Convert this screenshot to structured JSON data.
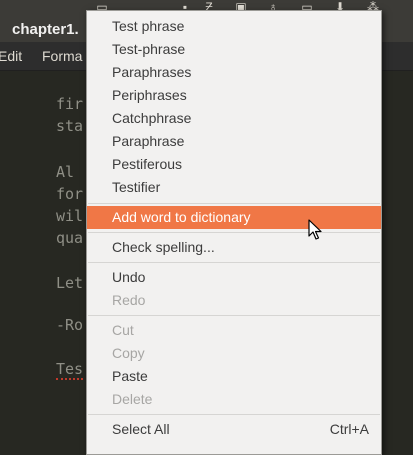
{
  "editor": {
    "tab_title": "chapter1.",
    "menu": [
      "Edit",
      "Forma"
    ],
    "lines": [
      "fir",
      "sta",
      "Al",
      "for",
      "wil",
      "qua",
      "Let",
      "-Ro",
      "Tes"
    ]
  },
  "context_menu": {
    "suggestions": [
      "Test phrase",
      "Test-phrase",
      "Paraphrases",
      "Periphrases",
      "Catchphrase",
      "Paraphrase",
      "Pestiferous",
      "Testifier"
    ],
    "add_to_dictionary": "Add word to dictionary",
    "check_spelling": "Check spelling...",
    "undo": "Undo",
    "redo": "Redo",
    "cut": "Cut",
    "copy": "Copy",
    "paste": "Paste",
    "delete": "Delete",
    "select_all": "Select All",
    "select_all_shortcut": "Ctrl+A"
  },
  "colors": {
    "highlight": "#f07746",
    "menu_bg": "#f2f1f0",
    "editor_bg": "#272822"
  }
}
